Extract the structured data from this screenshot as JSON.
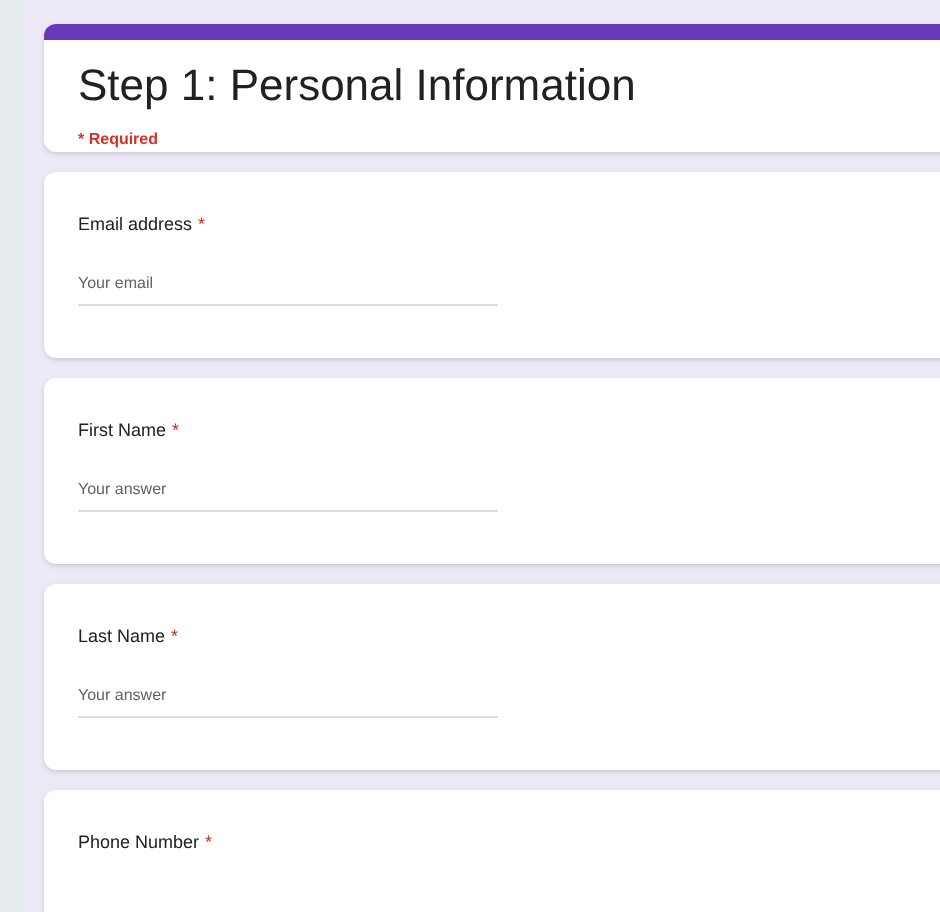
{
  "header": {
    "title": "Step 1: Personal Information",
    "required_note": "* Required"
  },
  "questions": [
    {
      "label": "Email address",
      "mark": "*",
      "placeholder": "Your email"
    },
    {
      "label": "First Name",
      "mark": "*",
      "placeholder": "Your answer"
    },
    {
      "label": "Last Name",
      "mark": "*",
      "placeholder": "Your answer"
    },
    {
      "label": "Phone Number",
      "mark": "*"
    }
  ]
}
